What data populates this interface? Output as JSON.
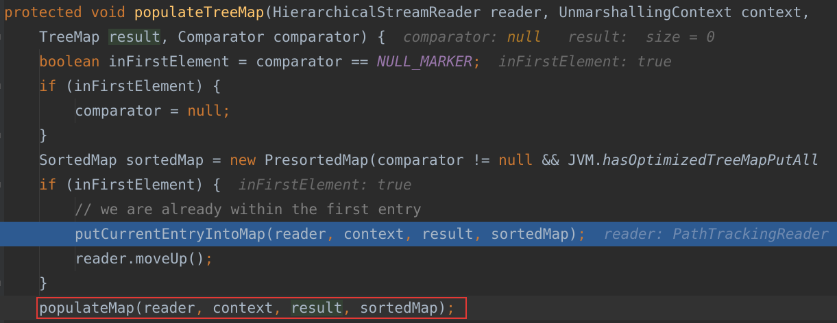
{
  "editor": {
    "lines": [
      {
        "id": "l1",
        "parts": [
          {
            "t": "protected",
            "c": "kw"
          },
          {
            "t": " "
          },
          {
            "t": "void",
            "c": "kw"
          },
          {
            "t": " "
          },
          {
            "t": "populateTreeMap",
            "c": "fn"
          },
          {
            "t": "(HierarchicalStreamReader reader, UnmarshallingContext context,"
          }
        ]
      },
      {
        "id": "l2",
        "parts": [
          {
            "t": "TreeMap "
          },
          {
            "t": "result",
            "c": "usage"
          },
          {
            "t": ", Comparator comparator) {  "
          },
          {
            "t": "comparator: ",
            "c": "hint"
          },
          {
            "t": "null",
            "c": "hint-kw"
          },
          {
            "t": "   result:  size = 0",
            "c": "hint"
          }
        ]
      },
      {
        "id": "l3",
        "parts": [
          {
            "t": "boolean",
            "c": "kw"
          },
          {
            "t": " inFirstElement = comparator == "
          },
          {
            "t": "NULL_MARKER",
            "c": "const"
          },
          {
            "t": ";",
            "c": "semi"
          },
          {
            "t": "  "
          },
          {
            "t": "inFirstElement: true",
            "c": "hint"
          }
        ]
      },
      {
        "id": "l4",
        "parts": [
          {
            "t": "if",
            "c": "kw"
          },
          {
            "t": " (inFirstElement) {"
          }
        ]
      },
      {
        "id": "l5",
        "parts": [
          {
            "t": "comparator = "
          },
          {
            "t": "null",
            "c": "kw"
          },
          {
            "t": ";",
            "c": "semi"
          }
        ]
      },
      {
        "id": "l6",
        "parts": [
          {
            "t": "}"
          }
        ]
      },
      {
        "id": "l7",
        "parts": [
          {
            "t": "SortedMap sortedMap = "
          },
          {
            "t": "new",
            "c": "kw"
          },
          {
            "t": " PresortedMap(comparator != "
          },
          {
            "t": "null",
            "c": "kw"
          },
          {
            "t": " && JVM."
          },
          {
            "t": "hasOptimizedTreeMapPutAll",
            "c": "static-call"
          }
        ]
      },
      {
        "id": "l8",
        "parts": [
          {
            "t": "if",
            "c": "kw"
          },
          {
            "t": " (inFirstElement) {  "
          },
          {
            "t": "inFirstElement: true",
            "c": "hint"
          }
        ]
      },
      {
        "id": "l9",
        "parts": [
          {
            "t": "// we are already within the first entry",
            "c": "cmt"
          }
        ]
      },
      {
        "id": "l10",
        "parts": [
          {
            "t": "putCurrentEntryIntoMap(reader"
          },
          {
            "t": ",",
            "c": "sel-kw"
          },
          {
            "t": " context"
          },
          {
            "t": ",",
            "c": "sel-kw"
          },
          {
            "t": " result"
          },
          {
            "t": ",",
            "c": "sel-kw"
          },
          {
            "t": " sortedMap)"
          },
          {
            "t": ";",
            "c": "sel-kw"
          },
          {
            "t": "  "
          },
          {
            "t": "reader: PathTrackingReader",
            "c": "hint-sel"
          }
        ]
      },
      {
        "id": "l11",
        "parts": [
          {
            "t": "reader.moveUp()"
          },
          {
            "t": ";",
            "c": "semi"
          }
        ]
      },
      {
        "id": "l12",
        "parts": [
          {
            "t": "}"
          }
        ]
      },
      {
        "id": "l13",
        "parts": [
          {
            "t": "populateMap(reader"
          },
          {
            "t": ",",
            "c": "semi"
          },
          {
            "t": " context"
          },
          {
            "t": ",",
            "c": "semi"
          },
          {
            "t": " "
          },
          {
            "t": "result",
            "c": "usage"
          },
          {
            "t": ",",
            "c": "semi"
          },
          {
            "t": " sortedMap)"
          },
          {
            "t": ";",
            "c": "semi"
          }
        ]
      }
    ]
  }
}
